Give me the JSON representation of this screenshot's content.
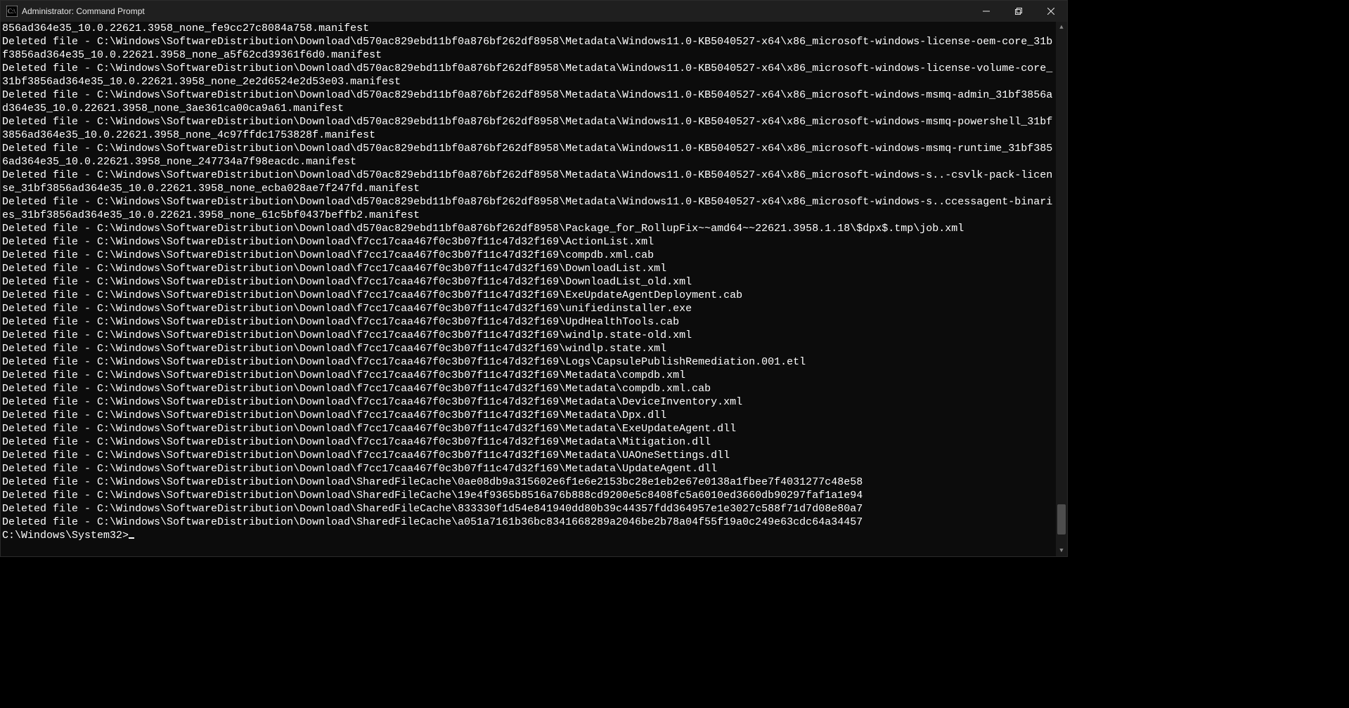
{
  "window": {
    "title": "Administrator: Command Prompt"
  },
  "scrollbar": {
    "thumb_top_pct": 92,
    "thumb_height_pct": 6
  },
  "prompt": "C:\\Windows\\System32>",
  "output_lines": [
    "856ad364e35_10.0.22621.3958_none_fe9cc27c8084a758.manifest",
    "Deleted file - C:\\Windows\\SoftwareDistribution\\Download\\d570ac829ebd11bf0a876bf262df8958\\Metadata\\Windows11.0-KB5040527-x64\\x86_microsoft-windows-license-oem-core_31bf3856ad364e35_10.0.22621.3958_none_a5f62cd39361f6d0.manifest",
    "Deleted file - C:\\Windows\\SoftwareDistribution\\Download\\d570ac829ebd11bf0a876bf262df8958\\Metadata\\Windows11.0-KB5040527-x64\\x86_microsoft-windows-license-volume-core_31bf3856ad364e35_10.0.22621.3958_none_2e2d6524e2d53e03.manifest",
    "Deleted file - C:\\Windows\\SoftwareDistribution\\Download\\d570ac829ebd11bf0a876bf262df8958\\Metadata\\Windows11.0-KB5040527-x64\\x86_microsoft-windows-msmq-admin_31bf3856ad364e35_10.0.22621.3958_none_3ae361ca00ca9a61.manifest",
    "Deleted file - C:\\Windows\\SoftwareDistribution\\Download\\d570ac829ebd11bf0a876bf262df8958\\Metadata\\Windows11.0-KB5040527-x64\\x86_microsoft-windows-msmq-powershell_31bf3856ad364e35_10.0.22621.3958_none_4c97ffdc1753828f.manifest",
    "Deleted file - C:\\Windows\\SoftwareDistribution\\Download\\d570ac829ebd11bf0a876bf262df8958\\Metadata\\Windows11.0-KB5040527-x64\\x86_microsoft-windows-msmq-runtime_31bf3856ad364e35_10.0.22621.3958_none_247734a7f98eacdc.manifest",
    "Deleted file - C:\\Windows\\SoftwareDistribution\\Download\\d570ac829ebd11bf0a876bf262df8958\\Metadata\\Windows11.0-KB5040527-x64\\x86_microsoft-windows-s..-csvlk-pack-license_31bf3856ad364e35_10.0.22621.3958_none_ecba028ae7f247fd.manifest",
    "Deleted file - C:\\Windows\\SoftwareDistribution\\Download\\d570ac829ebd11bf0a876bf262df8958\\Metadata\\Windows11.0-KB5040527-x64\\x86_microsoft-windows-s..ccessagent-binaries_31bf3856ad364e35_10.0.22621.3958_none_61c5bf0437beffb2.manifest",
    "Deleted file - C:\\Windows\\SoftwareDistribution\\Download\\d570ac829ebd11bf0a876bf262df8958\\Package_for_RollupFix~~amd64~~22621.3958.1.18\\$dpx$.tmp\\job.xml",
    "Deleted file - C:\\Windows\\SoftwareDistribution\\Download\\f7cc17caa467f0c3b07f11c47d32f169\\ActionList.xml",
    "Deleted file - C:\\Windows\\SoftwareDistribution\\Download\\f7cc17caa467f0c3b07f11c47d32f169\\compdb.xml.cab",
    "Deleted file - C:\\Windows\\SoftwareDistribution\\Download\\f7cc17caa467f0c3b07f11c47d32f169\\DownloadList.xml",
    "Deleted file - C:\\Windows\\SoftwareDistribution\\Download\\f7cc17caa467f0c3b07f11c47d32f169\\DownloadList_old.xml",
    "Deleted file - C:\\Windows\\SoftwareDistribution\\Download\\f7cc17caa467f0c3b07f11c47d32f169\\ExeUpdateAgentDeployment.cab",
    "Deleted file - C:\\Windows\\SoftwareDistribution\\Download\\f7cc17caa467f0c3b07f11c47d32f169\\unifiedinstaller.exe",
    "Deleted file - C:\\Windows\\SoftwareDistribution\\Download\\f7cc17caa467f0c3b07f11c47d32f169\\UpdHealthTools.cab",
    "Deleted file - C:\\Windows\\SoftwareDistribution\\Download\\f7cc17caa467f0c3b07f11c47d32f169\\windlp.state-old.xml",
    "Deleted file - C:\\Windows\\SoftwareDistribution\\Download\\f7cc17caa467f0c3b07f11c47d32f169\\windlp.state.xml",
    "Deleted file - C:\\Windows\\SoftwareDistribution\\Download\\f7cc17caa467f0c3b07f11c47d32f169\\Logs\\CapsulePublishRemediation.001.etl",
    "Deleted file - C:\\Windows\\SoftwareDistribution\\Download\\f7cc17caa467f0c3b07f11c47d32f169\\Metadata\\compdb.xml",
    "Deleted file - C:\\Windows\\SoftwareDistribution\\Download\\f7cc17caa467f0c3b07f11c47d32f169\\Metadata\\compdb.xml.cab",
    "Deleted file - C:\\Windows\\SoftwareDistribution\\Download\\f7cc17caa467f0c3b07f11c47d32f169\\Metadata\\DeviceInventory.xml",
    "Deleted file - C:\\Windows\\SoftwareDistribution\\Download\\f7cc17caa467f0c3b07f11c47d32f169\\Metadata\\Dpx.dll",
    "Deleted file - C:\\Windows\\SoftwareDistribution\\Download\\f7cc17caa467f0c3b07f11c47d32f169\\Metadata\\ExeUpdateAgent.dll",
    "Deleted file - C:\\Windows\\SoftwareDistribution\\Download\\f7cc17caa467f0c3b07f11c47d32f169\\Metadata\\Mitigation.dll",
    "Deleted file - C:\\Windows\\SoftwareDistribution\\Download\\f7cc17caa467f0c3b07f11c47d32f169\\Metadata\\UAOneSettings.dll",
    "Deleted file - C:\\Windows\\SoftwareDistribution\\Download\\f7cc17caa467f0c3b07f11c47d32f169\\Metadata\\UpdateAgent.dll",
    "Deleted file - C:\\Windows\\SoftwareDistribution\\Download\\SharedFileCache\\0ae08db9a315602e6f1e6e2153bc28e1eb2e67e0138a1fbee7f4031277c48e58",
    "Deleted file - C:\\Windows\\SoftwareDistribution\\Download\\SharedFileCache\\19e4f9365b8516a76b888cd9200e5c8408fc5a6010ed3660db90297faf1a1e94",
    "Deleted file - C:\\Windows\\SoftwareDistribution\\Download\\SharedFileCache\\833330f1d54e841940dd80b39c44357fdd364957e1e3027c588f71d7d08e80a7",
    "Deleted file - C:\\Windows\\SoftwareDistribution\\Download\\SharedFileCache\\a051a7161b36bc8341668289a2046be2b78a04f55f19a0c249e63cdc64a34457",
    ""
  ]
}
